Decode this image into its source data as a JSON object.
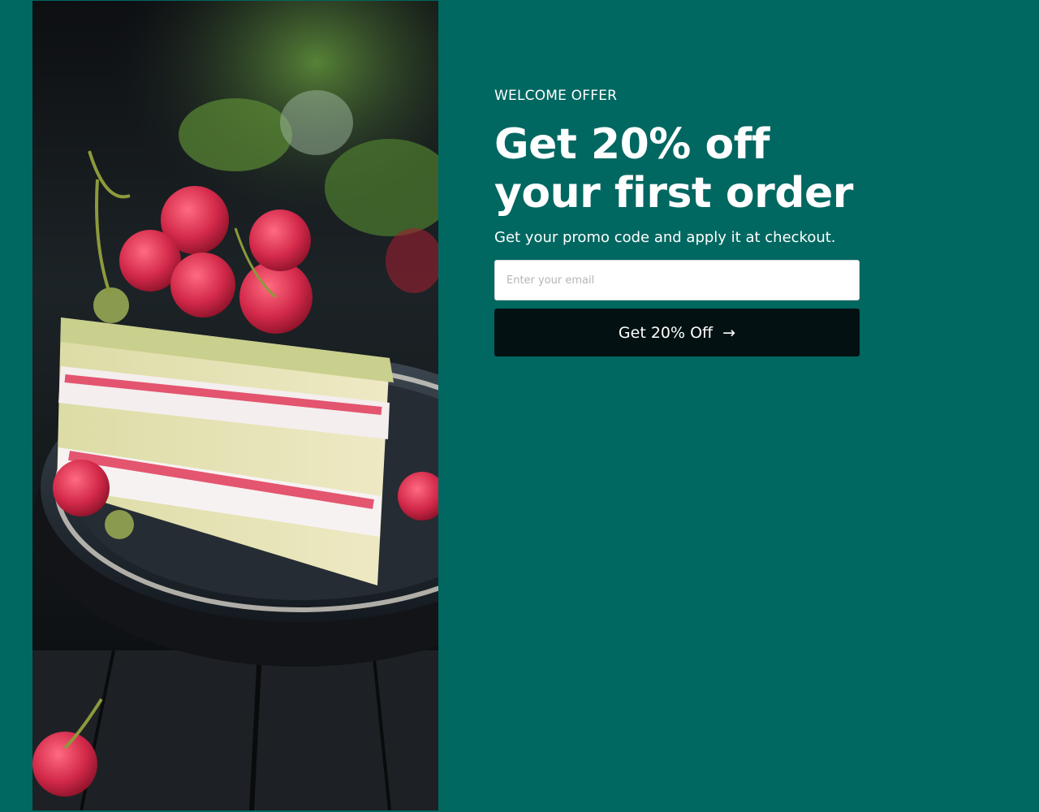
{
  "colors": {
    "background": "#006761",
    "button_bg": "#031112",
    "text": "#ffffff"
  },
  "hero": {
    "alt": "Slice of layered sponge cake topped with raspberries on a dark plate"
  },
  "offer": {
    "eyebrow": "WELCOME OFFER",
    "headline_line1": "Get 20% off",
    "headline_line2": "your first order",
    "subtext": "Get your promo code and apply it at checkout."
  },
  "form": {
    "email_placeholder": "Enter your email",
    "email_value": "",
    "submit_label": "Get 20% Off",
    "submit_icon": "arrow-right-icon"
  }
}
